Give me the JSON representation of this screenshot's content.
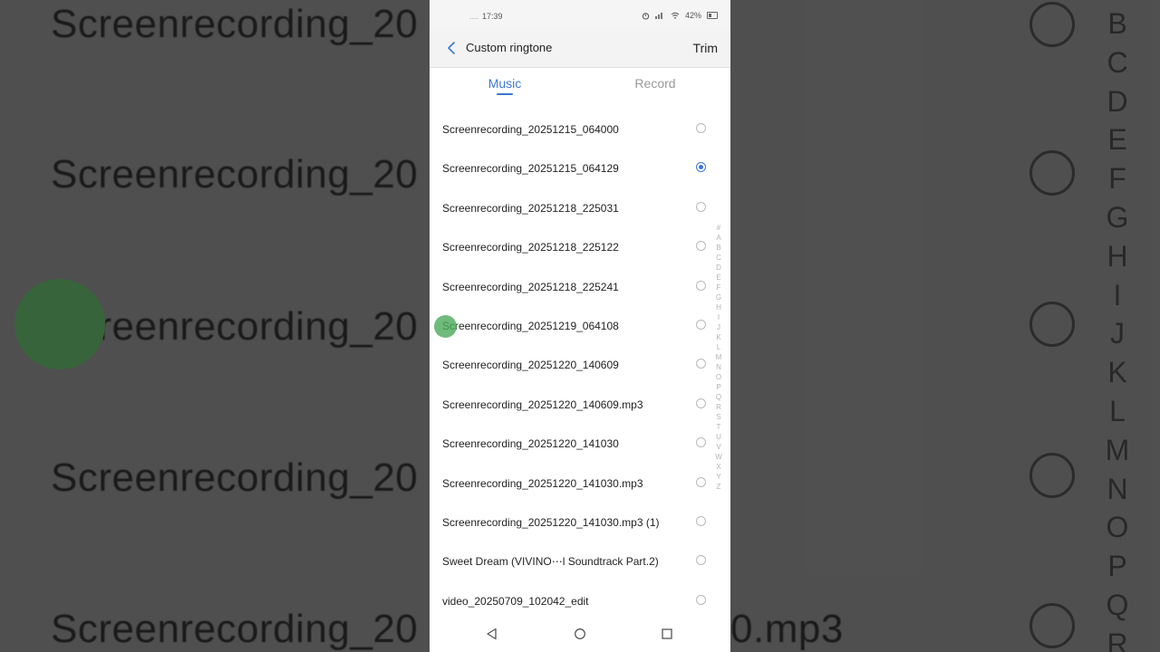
{
  "status_bar": {
    "time": "17:39",
    "signal_dots": "....",
    "battery_percent": "42%"
  },
  "header": {
    "title": "Custom ringtone",
    "action_label": "Trim"
  },
  "tabs": [
    {
      "label": "Music",
      "active": true
    },
    {
      "label": "Record",
      "active": false
    }
  ],
  "list": {
    "items": [
      {
        "label": "Screenrecording_20251215_064000",
        "selected": false
      },
      {
        "label": "Screenrecording_20251215_064129",
        "selected": true
      },
      {
        "label": "Screenrecording_20251218_225031",
        "selected": false
      },
      {
        "label": "Screenrecording_20251218_225122",
        "selected": false
      },
      {
        "label": "Screenrecording_20251218_225241",
        "selected": false
      },
      {
        "label": "Screenrecording_20251219_064108",
        "selected": false
      },
      {
        "label": "Screenrecording_20251220_140609",
        "selected": false
      },
      {
        "label": "Screenrecording_20251220_140609.mp3",
        "selected": false
      },
      {
        "label": "Screenrecording_20251220_141030",
        "selected": false
      },
      {
        "label": "Screenrecording_20251220_141030.mp3",
        "selected": false
      },
      {
        "label": "Screenrecording_20251220_141030.mp3 (1)",
        "selected": false
      },
      {
        "label": "Sweet Dream (VIVINO⋯l Soundtrack Part.2)",
        "selected": false
      },
      {
        "label": "video_20250709_102042_edit",
        "selected": false
      }
    ]
  },
  "index_letters": [
    "#",
    "A",
    "B",
    "C",
    "D",
    "E",
    "F",
    "G",
    "H",
    "I",
    "J",
    "K",
    "L",
    "M",
    "N",
    "O",
    "P",
    "Q",
    "R",
    "S",
    "T",
    "U",
    "V",
    "W",
    "X",
    "Y",
    "Z"
  ],
  "background": {
    "texts": [
      "Screenrecording_20",
      "Screenrecording_20",
      "Screenrecording_20",
      "Screenrecording_20",
      "Screenrecording_20"
    ],
    "last_text_suffix": "0.mp3",
    "letters": [
      "B",
      "C",
      "D",
      "E",
      "F",
      "G",
      "H",
      "I",
      "J",
      "K",
      "L",
      "M",
      "N",
      "O",
      "P",
      "Q",
      "R"
    ]
  },
  "colors": {
    "accent": "#3b78d4",
    "inactive_tab": "#9a9a9a",
    "touch_indicator": "#4aaa5a"
  },
  "icons": {
    "back": "chevron-left-icon",
    "nav_back": "triangle-back-icon",
    "nav_home": "circle-home-icon",
    "nav_recent": "square-recent-icon"
  }
}
